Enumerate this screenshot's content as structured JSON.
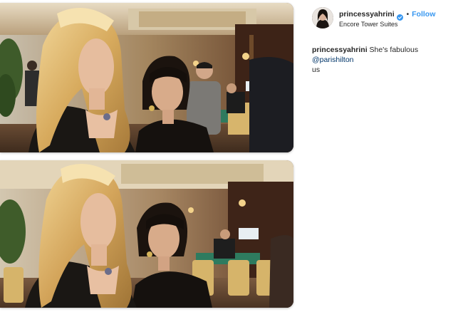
{
  "header": {
    "username": "princessyahrini",
    "separator": "•",
    "follow_label": "Follow",
    "location": "Encore Tower Suites"
  },
  "caption": {
    "username": "princessyahrini",
    "text": "She's fabulous",
    "mention": "@parishilton",
    "trailing": "us"
  },
  "icons": {
    "verified": "verified-badge-icon"
  },
  "colors": {
    "link_blue": "#3897f0",
    "mention_blue": "#003569",
    "verified_blue": "#3897f0",
    "text": "#262626"
  }
}
